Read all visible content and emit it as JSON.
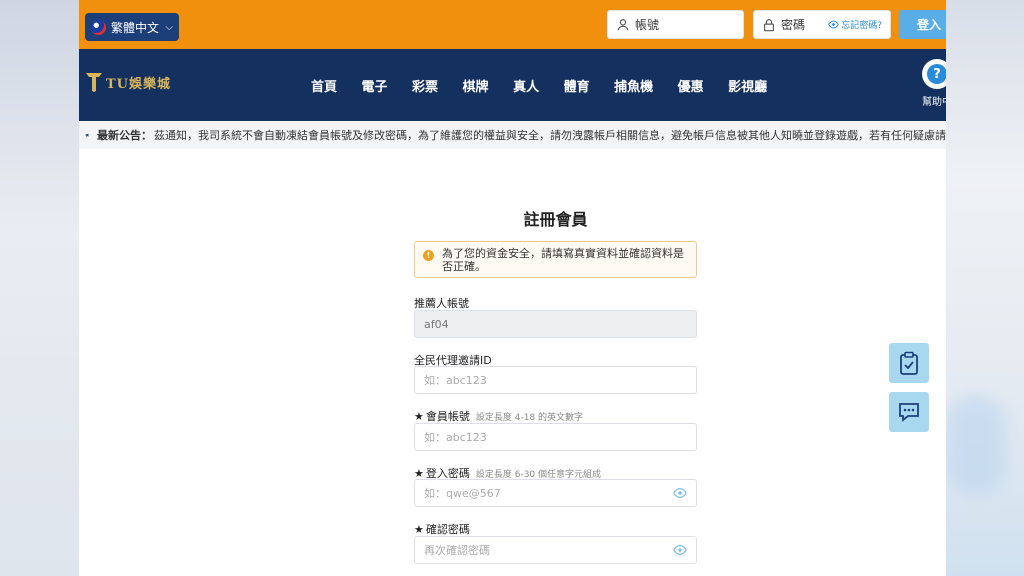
{
  "topbar": {
    "language": "繁體中文",
    "username_placeholder": "帳號",
    "password_placeholder": "密碼",
    "forgot_password": "忘記密碼?",
    "login_button": "登入"
  },
  "nav": {
    "logo_text": "TU娛樂城",
    "items": [
      "首頁",
      "電子",
      "彩票",
      "棋牌",
      "真人",
      "體育",
      "捕魚機",
      "優惠",
      "影視廳"
    ],
    "help_label": "幫助中"
  },
  "announcement": {
    "label": "最新公告：",
    "text": "茲通知，我司系統不會自動凍結會員帳號及修改密碼，為了維護您的權益與安全，請勿洩露帳戶相關信息，避免帳戶信息被其他人知曉並登錄遊戲，若有任何疑慮請"
  },
  "form": {
    "title": "註冊會員",
    "notice": "為了您的資金安全，請填寫真實資料並確認資料是否正確。",
    "referrer_label": "推薦人帳號",
    "referrer_value": "af04",
    "agent_label": "全民代理邀請ID",
    "agent_placeholder": "如：abc123",
    "account_label": "會員帳號",
    "account_hint": "設定長度 4-18 的英文數字",
    "account_placeholder": "如：abc123",
    "password_label": "登入密碼",
    "password_hint": "設定長度 6-30 個任意字元組成",
    "password_placeholder": "如：qwe@567",
    "confirm_label": "確認密碼",
    "confirm_placeholder": "再次確認密碼",
    "required_mark": "★"
  },
  "colors": {
    "topbar": "#f0900c",
    "navbar": "#14305e",
    "accent": "#2a8bd8",
    "login_button": "#5aaee8"
  }
}
